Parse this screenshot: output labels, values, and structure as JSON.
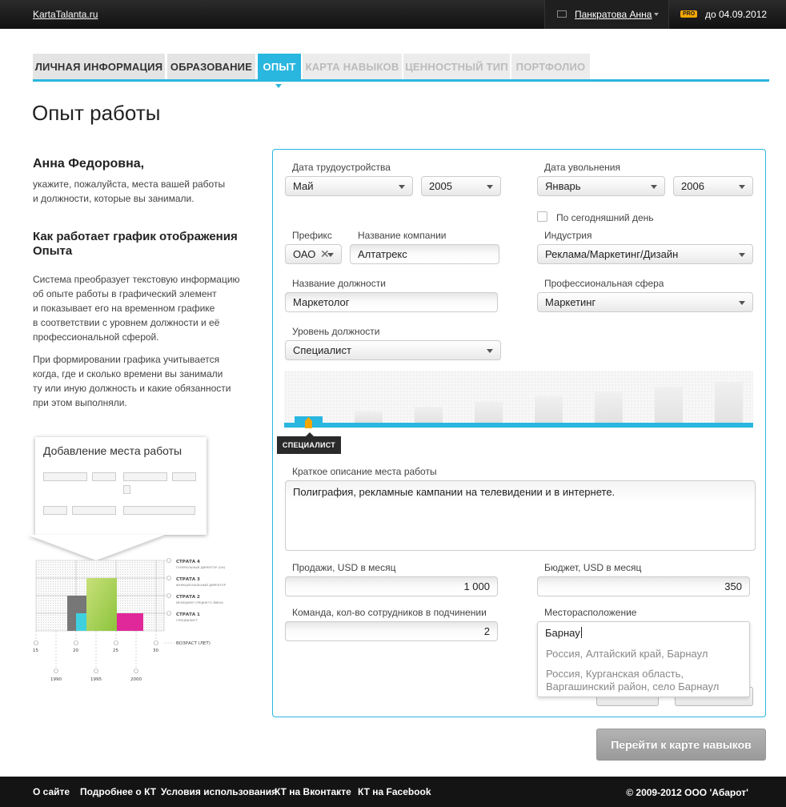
{
  "header": {
    "logo": "KartaTalanta.ru",
    "user_name": "Панкратова Анна",
    "pro_badge": "PRO",
    "subscription": "до 04.09.2012"
  },
  "tabs": [
    {
      "label": "ЛИЧНАЯ ИНФОРМАЦИЯ",
      "state": "normal"
    },
    {
      "label": "ОБРАЗОВАНИЕ",
      "state": "normal"
    },
    {
      "label": "ОПЫТ",
      "state": "active"
    },
    {
      "label": "КАРТА НАВЫКОВ",
      "state": "disabled"
    },
    {
      "label": "ЦЕННОСТНЫЙ ТИП",
      "state": "disabled"
    },
    {
      "label": "ПОРТФОЛИО",
      "state": "disabled"
    }
  ],
  "page_title": "Опыт работы",
  "left": {
    "greeting": "Анна Федоровна,",
    "intro_line1": "укажите, пожалуйста, места вашей работы",
    "intro_line2": "и должности, которые вы занимали.",
    "how_title": "Как работает график отображения Опыта",
    "p1_l1": "Система преобразует текстовую информацию",
    "p1_l2": "об опыте работы в графический элемент",
    "p1_l3": "и показывает его на временном графике",
    "p1_l4": "в соответствии с уровнем должности и её",
    "p1_l5": "профессиональной сферой.",
    "p2_l1": "При формировании графика учитывается",
    "p2_l2": "когда, где и сколько времени вы занимали",
    "p2_l3": "ту или иную должность и какие обязанности",
    "p2_l4": "при этом выполняли."
  },
  "illustration": {
    "card_title": "Добавление места работы",
    "strata": [
      {
        "name": "СТРАТА 4",
        "desc": "ГЕНЕРАЛЬНЫЙ ДИРЕКТОР (ОН)"
      },
      {
        "name": "СТРАТА 3",
        "desc": "ФУНКЦИОНАЛЬНЫЙ ДИРЕКТОР"
      },
      {
        "name": "СТРАТА 2",
        "desc": "МЕНЕДЖЕР СРЕДНЕГО ЗВЕНА"
      },
      {
        "name": "СТРАТА 1",
        "desc": "СПЕЦИАЛИСТ"
      }
    ],
    "age_label": "ВОЗРАСТ (ЛЕТ)",
    "ages": [
      "15",
      "20",
      "25",
      "30"
    ],
    "years": [
      "1990",
      "1995",
      "2000"
    ]
  },
  "form": {
    "hire_date_label": "Дата трудоустройства",
    "hire_month": "Май",
    "hire_year": "2005",
    "leave_date_label": "Дата увольнения",
    "leave_month": "Январь",
    "leave_year": "2006",
    "present_label": "По сегодняшний день",
    "prefix_label": "Префикс",
    "prefix_value": "ОАО",
    "company_label": "Название компании",
    "company_value": "Алтатрекс",
    "industry_label": "Индустрия",
    "industry_value": "Реклама/Маркетинг/Дизайн",
    "position_label": "Название должности",
    "position_value": "Маркетолог",
    "sphere_label": "Профессиональная сфера",
    "sphere_value": "Маркетинг",
    "level_label": "Уровень должности",
    "level_value": "Специалист",
    "level_tag": "СПЕЦИАЛИСТ",
    "desc_label": "Краткое описание места работы",
    "desc_value": "Полиграфия, рекламные кампании на телевидении и в интернете.",
    "sales_label": "Продажи, USD в месяц",
    "sales_value": "1 000",
    "budget_label": "Бюджет, USD в месяц",
    "budget_value": "350",
    "team_label": "Команда, кол-во сотрудников в подчинении",
    "team_value": "2",
    "location_label": "Месторасположение",
    "location_value": "Барнау",
    "location_suggestions": [
      "Россия, Алтайский край, Барнаул",
      "Россия, Курганская область,",
      "Варгашинский район, село Барнаул"
    ]
  },
  "next_button": "Перейти к карте навыков",
  "footer": {
    "links": [
      "О сайте",
      "Подробнее о КТ",
      "Условия использования",
      "КТ на Вконтакте",
      "КТ на Facebook"
    ],
    "copyright": "© 2009-2012 ООО 'Абарот'"
  },
  "colors": {
    "accent": "#29b6df",
    "pro": "#f5a700",
    "pin": "#f5a700"
  }
}
